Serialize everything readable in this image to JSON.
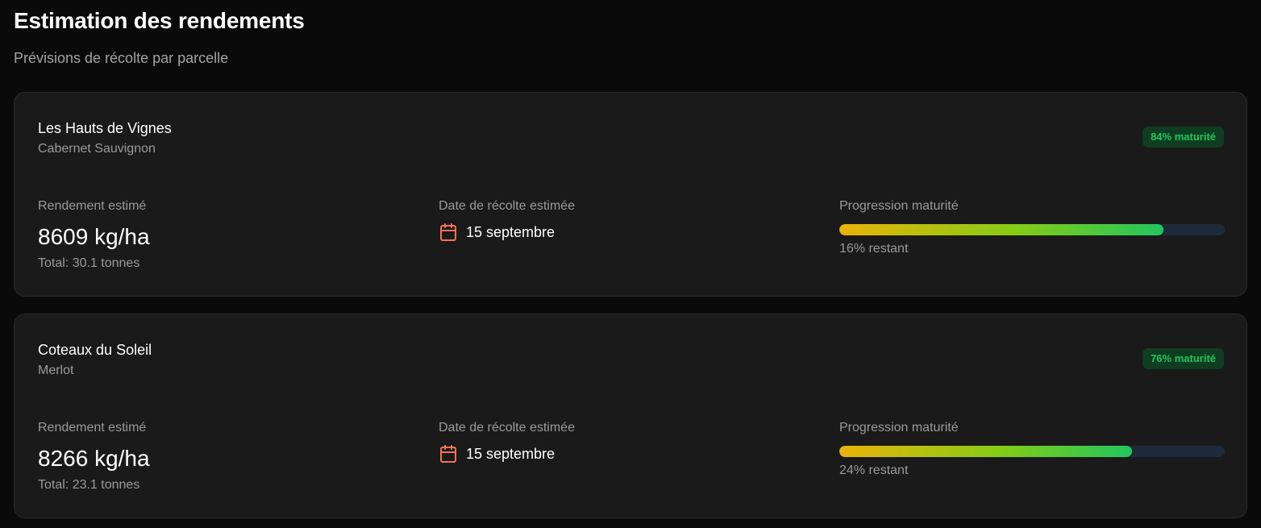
{
  "header": {
    "title": "Estimation des rendements",
    "subtitle": "Prévisions de récolte par parcelle"
  },
  "labels": {
    "yield": "Rendement estimé",
    "harvest_date": "Date de récolte estimée",
    "progress": "Progression maturité"
  },
  "colors": {
    "accent_green": "#22c55e",
    "calendar_orange": "#f97350",
    "progress_start": "#eab308",
    "progress_end": "#22c55e"
  },
  "parcels": [
    {
      "name": "Les Hauts de Vignes",
      "variety": "Cabernet Sauvignon",
      "badge": "84% maturité",
      "maturity": 0.84,
      "yield": "8609 kg/ha",
      "total": "Total: 30.1 tonnes",
      "harvest_date": "15 septembre",
      "remaining": "16% restant",
      "icon": "calendar-icon"
    },
    {
      "name": "Coteaux du Soleil",
      "variety": "Merlot",
      "badge": "76% maturité",
      "maturity": 0.76,
      "yield": "8266 kg/ha",
      "total": "Total: 23.1 tonnes",
      "harvest_date": "15 septembre",
      "remaining": "24% restant",
      "icon": "calendar-icon"
    }
  ]
}
